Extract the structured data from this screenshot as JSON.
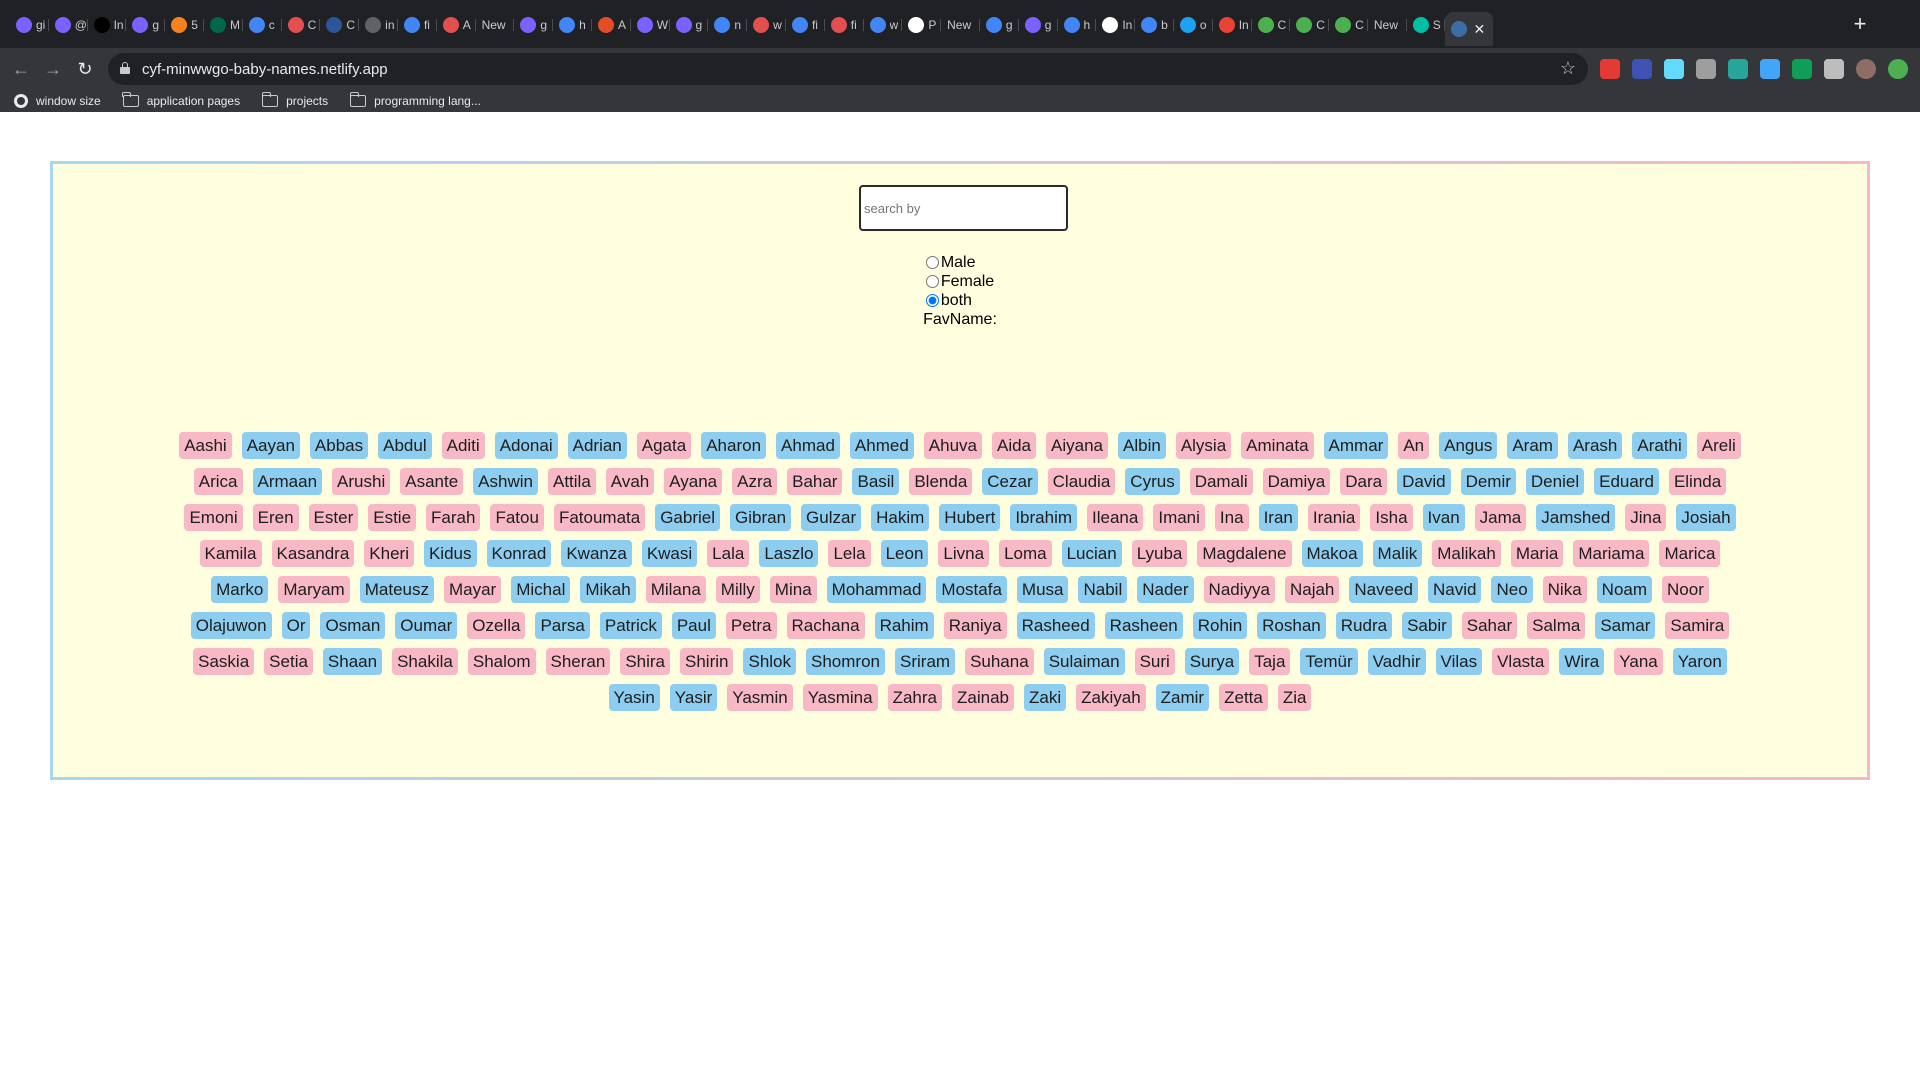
{
  "browser": {
    "tabs": [
      {
        "title": "gi",
        "icon": "github-graphql-icon",
        "color": "#7b61ff"
      },
      {
        "title": "@",
        "icon": "github-graphql-icon",
        "color": "#7b61ff"
      },
      {
        "title": "In",
        "icon": "dark-logo-icon",
        "color": "#000000"
      },
      {
        "title": "g",
        "icon": "github-graphql-icon",
        "color": "#7b61ff"
      },
      {
        "title": "5",
        "icon": "cloud-icon",
        "color": "#f6821f"
      },
      {
        "title": "M",
        "icon": "mongodb-icon",
        "color": "#00684a"
      },
      {
        "title": "c",
        "icon": "google-icon",
        "color": "#4285f4"
      },
      {
        "title": "C",
        "icon": "codewars-icon",
        "color": "#e34f4f"
      },
      {
        "title": "C",
        "icon": "word-icon",
        "color": "#2b579a"
      },
      {
        "title": "in",
        "icon": "globe-icon",
        "color": "#5f6368"
      },
      {
        "title": "fi",
        "icon": "google-icon",
        "color": "#4285f4"
      },
      {
        "title": "A",
        "icon": "codewars-icon",
        "color": "#e34f4f"
      },
      {
        "title": "New",
        "icon": "new-tab",
        "color": ""
      },
      {
        "title": "g",
        "icon": "github-graphql-icon",
        "color": "#7b61ff"
      },
      {
        "title": "h",
        "icon": "google-icon",
        "color": "#4285f4"
      },
      {
        "title": "A",
        "icon": "code-icon",
        "color": "#e44d26"
      },
      {
        "title": "W",
        "icon": "github-graphql-icon",
        "color": "#7b61ff"
      },
      {
        "title": "g",
        "icon": "github-graphql-icon",
        "color": "#7b61ff"
      },
      {
        "title": "n",
        "icon": "google-icon",
        "color": "#4285f4"
      },
      {
        "title": "w",
        "icon": "codewars-icon",
        "color": "#e34f4f"
      },
      {
        "title": "fi",
        "icon": "google-icon",
        "color": "#4285f4"
      },
      {
        "title": "fi",
        "icon": "codewars-icon",
        "color": "#e34f4f"
      },
      {
        "title": "w",
        "icon": "google-icon",
        "color": "#4285f4"
      },
      {
        "title": "P",
        "icon": "white-circle-icon",
        "color": "#ffffff"
      },
      {
        "title": "New",
        "icon": "new-tab",
        "color": ""
      },
      {
        "title": "g",
        "icon": "google-icon",
        "color": "#4285f4"
      },
      {
        "title": "g",
        "icon": "github-graphql-icon",
        "color": "#7b61ff"
      },
      {
        "title": "h",
        "icon": "google-icon",
        "color": "#4285f4"
      },
      {
        "title": "In",
        "icon": "github-icon",
        "color": "#ffffff"
      },
      {
        "title": "b",
        "icon": "google-icon",
        "color": "#4285f4"
      },
      {
        "title": "o",
        "icon": "square-icon",
        "color": "#1da1f2"
      },
      {
        "title": "In",
        "icon": "gmail-icon",
        "color": "#ea4335"
      },
      {
        "title": "C",
        "icon": "chart-icon",
        "color": "#4caf50"
      },
      {
        "title": "C",
        "icon": "chart-icon",
        "color": "#4caf50"
      },
      {
        "title": "C",
        "icon": "chart-icon",
        "color": "#4caf50"
      },
      {
        "title": "New",
        "icon": "new-tab",
        "color": ""
      },
      {
        "title": "S",
        "icon": "diamond-icon",
        "color": "#00bfa5"
      }
    ],
    "active_tab_icon": "react-icon",
    "active_tab_close": "✕",
    "new_tab_symbol": "+",
    "nav": {
      "back": "←",
      "forward": "→",
      "reload": "↻"
    },
    "url": "cyf-minwwgo-baby-names.netlify.app",
    "star": "☆",
    "extensions": [
      {
        "icon": "red-extension-icon",
        "color": "#e53935"
      },
      {
        "icon": "blue-grid-extension-icon",
        "color": "#3f51b5"
      },
      {
        "icon": "react-devtools-icon",
        "color": "#61dafb"
      },
      {
        "icon": "grey-extension-icon",
        "color": "#9e9e9e"
      },
      {
        "icon": "teal-m-extension-icon",
        "color": "#26a69a"
      },
      {
        "icon": "blue-circle-extension-icon",
        "color": "#42a5f5"
      },
      {
        "icon": "green-g-extension-icon",
        "color": "#0f9d58"
      },
      {
        "icon": "puzzle-icon",
        "color": "#bdbdbd"
      },
      {
        "icon": "avatar",
        "color": "#8d6e63"
      },
      {
        "icon": "green-status-icon",
        "color": "#4caf50"
      }
    ],
    "bookmarks": [
      {
        "label": "window size",
        "icon": "globe-icon"
      },
      {
        "label": "application pages",
        "icon": "folder-icon"
      },
      {
        "label": "projects",
        "icon": "folder-icon"
      },
      {
        "label": "programming lang...",
        "icon": "folder-icon"
      }
    ]
  },
  "app": {
    "search": {
      "placeholder": "search by",
      "value": ""
    },
    "gender_options": [
      {
        "label": "Male",
        "value": "male",
        "checked": false
      },
      {
        "label": "Female",
        "value": "female",
        "checked": false
      },
      {
        "label": "both",
        "value": "both",
        "checked": true
      }
    ],
    "fav_label": "FavName:",
    "colors": {
      "girl": "#f9b8c6",
      "boy": "#8ccdf0",
      "panel_bg": "#ffffe0"
    },
    "names": [
      {
        "name": "Aashi",
        "sex": "f"
      },
      {
        "name": "Aayan",
        "sex": "m"
      },
      {
        "name": "Abbas",
        "sex": "m"
      },
      {
        "name": "Abdul",
        "sex": "m"
      },
      {
        "name": "Aditi",
        "sex": "f"
      },
      {
        "name": "Adonai",
        "sex": "m"
      },
      {
        "name": "Adrian",
        "sex": "m"
      },
      {
        "name": "Agata",
        "sex": "f"
      },
      {
        "name": "Aharon",
        "sex": "m"
      },
      {
        "name": "Ahmad",
        "sex": "m"
      },
      {
        "name": "Ahmed",
        "sex": "m"
      },
      {
        "name": "Ahuva",
        "sex": "f"
      },
      {
        "name": "Aida",
        "sex": "f"
      },
      {
        "name": "Aiyana",
        "sex": "f"
      },
      {
        "name": "Albin",
        "sex": "m"
      },
      {
        "name": "Alysia",
        "sex": "f"
      },
      {
        "name": "Aminata",
        "sex": "f"
      },
      {
        "name": "Ammar",
        "sex": "m"
      },
      {
        "name": "An",
        "sex": "f"
      },
      {
        "name": "Angus",
        "sex": "m"
      },
      {
        "name": "Aram",
        "sex": "m"
      },
      {
        "name": "Arash",
        "sex": "m"
      },
      {
        "name": "Arathi",
        "sex": "m"
      },
      {
        "name": "Areli",
        "sex": "f"
      },
      {
        "name": "Arica",
        "sex": "f"
      },
      {
        "name": "Armaan",
        "sex": "m"
      },
      {
        "name": "Arushi",
        "sex": "f"
      },
      {
        "name": "Asante",
        "sex": "f"
      },
      {
        "name": "Ashwin",
        "sex": "m"
      },
      {
        "name": "Attila",
        "sex": "f"
      },
      {
        "name": "Avah",
        "sex": "f"
      },
      {
        "name": "Ayana",
        "sex": "f"
      },
      {
        "name": "Azra",
        "sex": "f"
      },
      {
        "name": "Bahar",
        "sex": "f"
      },
      {
        "name": "Basil",
        "sex": "m"
      },
      {
        "name": "Blenda",
        "sex": "f"
      },
      {
        "name": "Cezar",
        "sex": "m"
      },
      {
        "name": "Claudia",
        "sex": "f"
      },
      {
        "name": "Cyrus",
        "sex": "m"
      },
      {
        "name": "Damali",
        "sex": "f"
      },
      {
        "name": "Damiya",
        "sex": "f"
      },
      {
        "name": "Dara",
        "sex": "f"
      },
      {
        "name": "David",
        "sex": "m"
      },
      {
        "name": "Demir",
        "sex": "m"
      },
      {
        "name": "Deniel",
        "sex": "m"
      },
      {
        "name": "Eduard",
        "sex": "m"
      },
      {
        "name": "Elinda",
        "sex": "f"
      },
      {
        "name": "Emoni",
        "sex": "f"
      },
      {
        "name": "Eren",
        "sex": "f"
      },
      {
        "name": "Ester",
        "sex": "f"
      },
      {
        "name": "Estie",
        "sex": "f"
      },
      {
        "name": "Farah",
        "sex": "f"
      },
      {
        "name": "Fatou",
        "sex": "f"
      },
      {
        "name": "Fatoumata",
        "sex": "f"
      },
      {
        "name": "Gabriel",
        "sex": "m"
      },
      {
        "name": "Gibran",
        "sex": "m"
      },
      {
        "name": "Gulzar",
        "sex": "m"
      },
      {
        "name": "Hakim",
        "sex": "m"
      },
      {
        "name": "Hubert",
        "sex": "m"
      },
      {
        "name": "Ibrahim",
        "sex": "m"
      },
      {
        "name": "Ileana",
        "sex": "f"
      },
      {
        "name": "Imani",
        "sex": "f"
      },
      {
        "name": "Ina",
        "sex": "f"
      },
      {
        "name": "Iran",
        "sex": "m"
      },
      {
        "name": "Irania",
        "sex": "f"
      },
      {
        "name": "Isha",
        "sex": "f"
      },
      {
        "name": "Ivan",
        "sex": "m"
      },
      {
        "name": "Jama",
        "sex": "f"
      },
      {
        "name": "Jamshed",
        "sex": "m"
      },
      {
        "name": "Jina",
        "sex": "f"
      },
      {
        "name": "Josiah",
        "sex": "m"
      },
      {
        "name": "Kamila",
        "sex": "f"
      },
      {
        "name": "Kasandra",
        "sex": "f"
      },
      {
        "name": "Kheri",
        "sex": "f"
      },
      {
        "name": "Kidus",
        "sex": "m"
      },
      {
        "name": "Konrad",
        "sex": "m"
      },
      {
        "name": "Kwanza",
        "sex": "m"
      },
      {
        "name": "Kwasi",
        "sex": "m"
      },
      {
        "name": "Lala",
        "sex": "f"
      },
      {
        "name": "Laszlo",
        "sex": "m"
      },
      {
        "name": "Lela",
        "sex": "f"
      },
      {
        "name": "Leon",
        "sex": "m"
      },
      {
        "name": "Livna",
        "sex": "f"
      },
      {
        "name": "Loma",
        "sex": "f"
      },
      {
        "name": "Lucian",
        "sex": "m"
      },
      {
        "name": "Lyuba",
        "sex": "f"
      },
      {
        "name": "Magdalene",
        "sex": "f"
      },
      {
        "name": "Makoa",
        "sex": "m"
      },
      {
        "name": "Malik",
        "sex": "m"
      },
      {
        "name": "Malikah",
        "sex": "f"
      },
      {
        "name": "Maria",
        "sex": "f"
      },
      {
        "name": "Mariama",
        "sex": "f"
      },
      {
        "name": "Marica",
        "sex": "f"
      },
      {
        "name": "Marko",
        "sex": "m"
      },
      {
        "name": "Maryam",
        "sex": "f"
      },
      {
        "name": "Mateusz",
        "sex": "m"
      },
      {
        "name": "Mayar",
        "sex": "f"
      },
      {
        "name": "Michal",
        "sex": "m"
      },
      {
        "name": "Mikah",
        "sex": "m"
      },
      {
        "name": "Milana",
        "sex": "f"
      },
      {
        "name": "Milly",
        "sex": "f"
      },
      {
        "name": "Mina",
        "sex": "f"
      },
      {
        "name": "Mohammad",
        "sex": "m"
      },
      {
        "name": "Mostafa",
        "sex": "m"
      },
      {
        "name": "Musa",
        "sex": "m"
      },
      {
        "name": "Nabil",
        "sex": "m"
      },
      {
        "name": "Nader",
        "sex": "m"
      },
      {
        "name": "Nadiyya",
        "sex": "f"
      },
      {
        "name": "Najah",
        "sex": "f"
      },
      {
        "name": "Naveed",
        "sex": "m"
      },
      {
        "name": "Navid",
        "sex": "m"
      },
      {
        "name": "Neo",
        "sex": "m"
      },
      {
        "name": "Nika",
        "sex": "f"
      },
      {
        "name": "Noam",
        "sex": "m"
      },
      {
        "name": "Noor",
        "sex": "f"
      },
      {
        "name": "Olajuwon",
        "sex": "m"
      },
      {
        "name": "Or",
        "sex": "m"
      },
      {
        "name": "Osman",
        "sex": "m"
      },
      {
        "name": "Oumar",
        "sex": "m"
      },
      {
        "name": "Ozella",
        "sex": "f"
      },
      {
        "name": "Parsa",
        "sex": "m"
      },
      {
        "name": "Patrick",
        "sex": "m"
      },
      {
        "name": "Paul",
        "sex": "m"
      },
      {
        "name": "Petra",
        "sex": "f"
      },
      {
        "name": "Rachana",
        "sex": "f"
      },
      {
        "name": "Rahim",
        "sex": "m"
      },
      {
        "name": "Raniya",
        "sex": "f"
      },
      {
        "name": "Rasheed",
        "sex": "m"
      },
      {
        "name": "Rasheen",
        "sex": "m"
      },
      {
        "name": "Rohin",
        "sex": "m"
      },
      {
        "name": "Roshan",
        "sex": "m"
      },
      {
        "name": "Rudra",
        "sex": "m"
      },
      {
        "name": "Sabir",
        "sex": "m"
      },
      {
        "name": "Sahar",
        "sex": "f"
      },
      {
        "name": "Salma",
        "sex": "f"
      },
      {
        "name": "Samar",
        "sex": "m"
      },
      {
        "name": "Samira",
        "sex": "f"
      },
      {
        "name": "Saskia",
        "sex": "f"
      },
      {
        "name": "Setia",
        "sex": "f"
      },
      {
        "name": "Shaan",
        "sex": "m"
      },
      {
        "name": "Shakila",
        "sex": "f"
      },
      {
        "name": "Shalom",
        "sex": "f"
      },
      {
        "name": "Sheran",
        "sex": "f"
      },
      {
        "name": "Shira",
        "sex": "f"
      },
      {
        "name": "Shirin",
        "sex": "f"
      },
      {
        "name": "Shlok",
        "sex": "m"
      },
      {
        "name": "Shomron",
        "sex": "m"
      },
      {
        "name": "Sriram",
        "sex": "m"
      },
      {
        "name": "Suhana",
        "sex": "f"
      },
      {
        "name": "Sulaiman",
        "sex": "m"
      },
      {
        "name": "Suri",
        "sex": "f"
      },
      {
        "name": "Surya",
        "sex": "m"
      },
      {
        "name": "Taja",
        "sex": "f"
      },
      {
        "name": "Temür",
        "sex": "m"
      },
      {
        "name": "Vadhir",
        "sex": "m"
      },
      {
        "name": "Vilas",
        "sex": "m"
      },
      {
        "name": "Vlasta",
        "sex": "f"
      },
      {
        "name": "Wira",
        "sex": "m"
      },
      {
        "name": "Yana",
        "sex": "f"
      },
      {
        "name": "Yaron",
        "sex": "m"
      },
      {
        "name": "Yasin",
        "sex": "m"
      },
      {
        "name": "Yasir",
        "sex": "m"
      },
      {
        "name": "Yasmin",
        "sex": "f"
      },
      {
        "name": "Yasmina",
        "sex": "f"
      },
      {
        "name": "Zahra",
        "sex": "f"
      },
      {
        "name": "Zainab",
        "sex": "f"
      },
      {
        "name": "Zaki",
        "sex": "m"
      },
      {
        "name": "Zakiyah",
        "sex": "f"
      },
      {
        "name": "Zamir",
        "sex": "m"
      },
      {
        "name": "Zetta",
        "sex": "f"
      },
      {
        "name": "Zia",
        "sex": "f"
      }
    ]
  }
}
